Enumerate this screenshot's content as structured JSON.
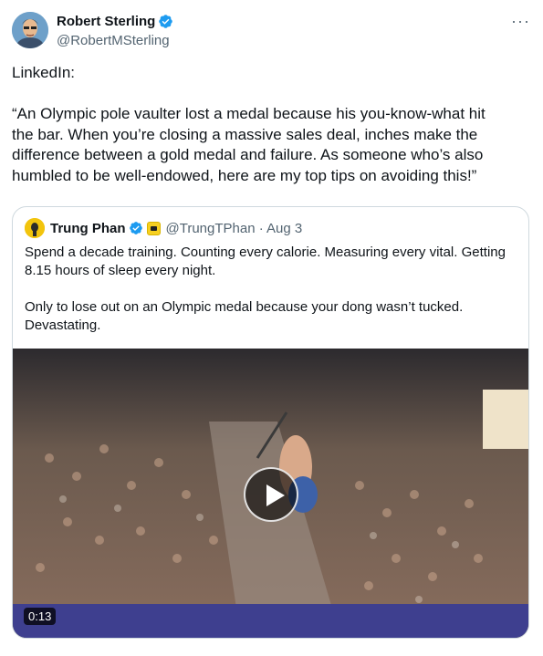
{
  "author": {
    "display_name": "Robert Sterling",
    "handle": "@RobertMSterling",
    "verified": true
  },
  "menu": {
    "more_icon": "more-icon",
    "glyph": "···"
  },
  "tweet": {
    "lines": [
      "LinkedIn:",
      "",
      "“An Olympic pole vaulter lost a medal because his you-know-what hit",
      "the bar. When you’re closing a massive sales deal, inches make the",
      "difference between a gold medal and failure. As someone who’s also",
      "humbled to be well-endowed, here are my top tips on avoiding this!”"
    ]
  },
  "quoted": {
    "display_name": "Trung Phan",
    "handle_date": "@TrungTPhan · Aug 3",
    "verified": true,
    "lines": [
      "Spend a decade training. Counting every calorie. Measuring every vital. Getting",
      "8.15 hours of sleep every night.",
      "",
      "Only to lose out on an Olympic medal because your dong wasn’t tucked.",
      "Devastating."
    ],
    "video": {
      "duration": "0:13",
      "play_icon": "play-icon"
    }
  },
  "colors": {
    "verified_blue": "#1d9bf0",
    "secondary_text": "#536471",
    "border": "#cfd9de"
  }
}
